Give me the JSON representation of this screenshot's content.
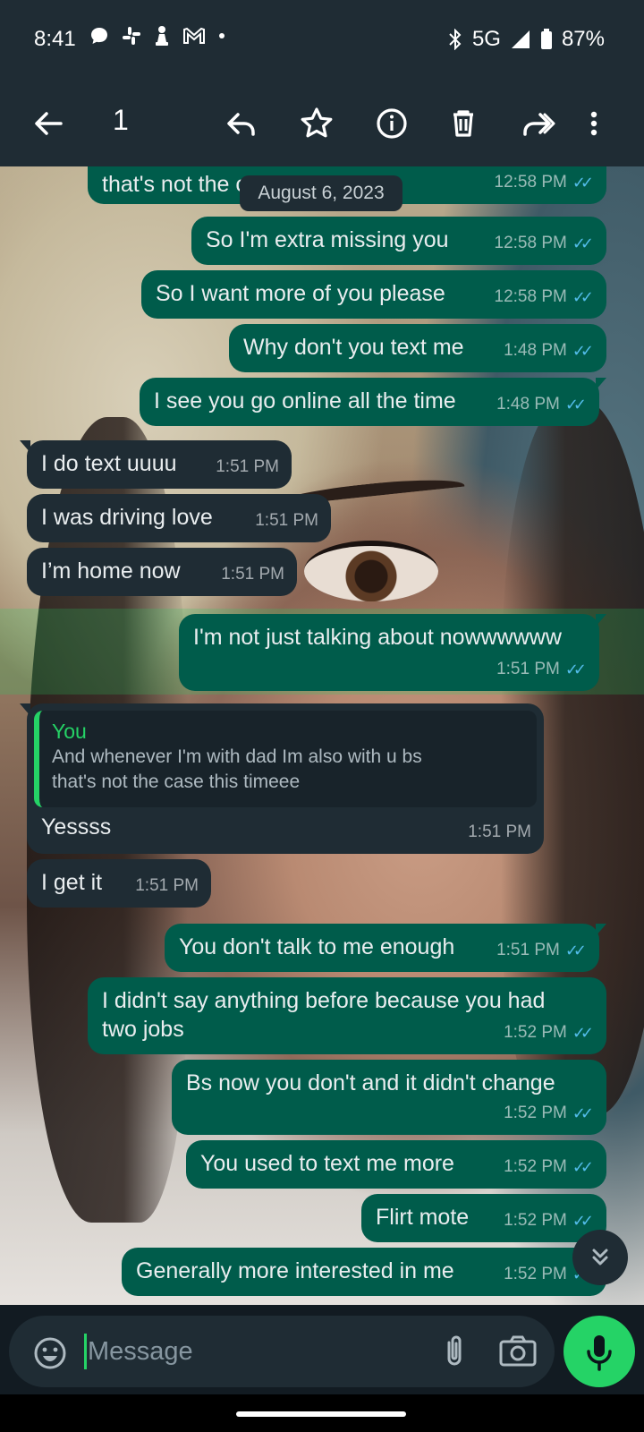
{
  "status_bar": {
    "time": "8:41",
    "network": "5G",
    "battery": "87%",
    "left_icons": [
      "chat-bubble-icon",
      "slack-icon",
      "chess-pawn-icon",
      "gmail-icon",
      "dot-icon"
    ],
    "right_icons": [
      "bluetooth-icon",
      "signal-icon",
      "battery-icon"
    ]
  },
  "action_bar": {
    "selected_count": "1",
    "actions": [
      "back-arrow-icon",
      "reply-icon",
      "star-icon",
      "info-icon",
      "delete-icon",
      "forward-icon",
      "more-vert-icon"
    ]
  },
  "date_pill": "August 6, 2023",
  "messages": [
    {
      "dir": "out",
      "text": "that's not the case this timeee",
      "time": "12:58 PM",
      "read": true
    },
    {
      "dir": "out",
      "text": "So I'm extra missing you",
      "time": "12:58 PM",
      "read": true
    },
    {
      "dir": "out",
      "text": "So I want more of you please",
      "time": "12:58 PM",
      "read": true
    },
    {
      "dir": "out",
      "text": "Why don't you text me",
      "time": "1:48 PM",
      "read": true
    },
    {
      "dir": "out",
      "text": "I see you go online all the time",
      "time": "1:48 PM",
      "read": true
    },
    {
      "dir": "in",
      "text": "I do text uuuu",
      "time": "1:51 PM"
    },
    {
      "dir": "in",
      "text": "I was driving love",
      "time": "1:51 PM"
    },
    {
      "dir": "in",
      "text": "I’m home now",
      "time": "1:51 PM"
    },
    {
      "dir": "out",
      "text": "I'm not just talking about nowwwwww",
      "time": "1:51 PM",
      "read": true,
      "selected": true
    },
    {
      "dir": "in",
      "text": "Yessss",
      "time": "1:51 PM",
      "quote": {
        "author": "You",
        "line1": "And whenever I'm with dad Im also with u bs",
        "line2": "that's not the case this timeee"
      }
    },
    {
      "dir": "in",
      "text": "I get it",
      "time": "1:51 PM"
    },
    {
      "dir": "out",
      "text": "You don't talk to me enough",
      "time": "1:51 PM",
      "read": true
    },
    {
      "dir": "out",
      "text_line1": "I didn't say anything before because you had",
      "text_line2": "two jobs",
      "time": "1:52 PM",
      "read": true
    },
    {
      "dir": "out",
      "text": "Bs now you don't and it didn't change",
      "time": "1:52 PM",
      "read": true
    },
    {
      "dir": "out",
      "text": "You used to text me more",
      "time": "1:52 PM",
      "read": true
    },
    {
      "dir": "out",
      "text": "Flirt mote",
      "time": "1:52 PM",
      "read": true
    },
    {
      "dir": "out",
      "text": "Generally more interested in me",
      "time": "1:52 PM",
      "read": true
    }
  ],
  "composer": {
    "placeholder": "Message",
    "icons": [
      "emoji-icon",
      "attach-icon",
      "camera-icon",
      "mic-icon"
    ]
  },
  "colors": {
    "outgoing_bubble": "#005c4b",
    "incoming_bubble": "#1f2c34",
    "accent": "#25d366",
    "read_ticks": "#53bdeb"
  }
}
